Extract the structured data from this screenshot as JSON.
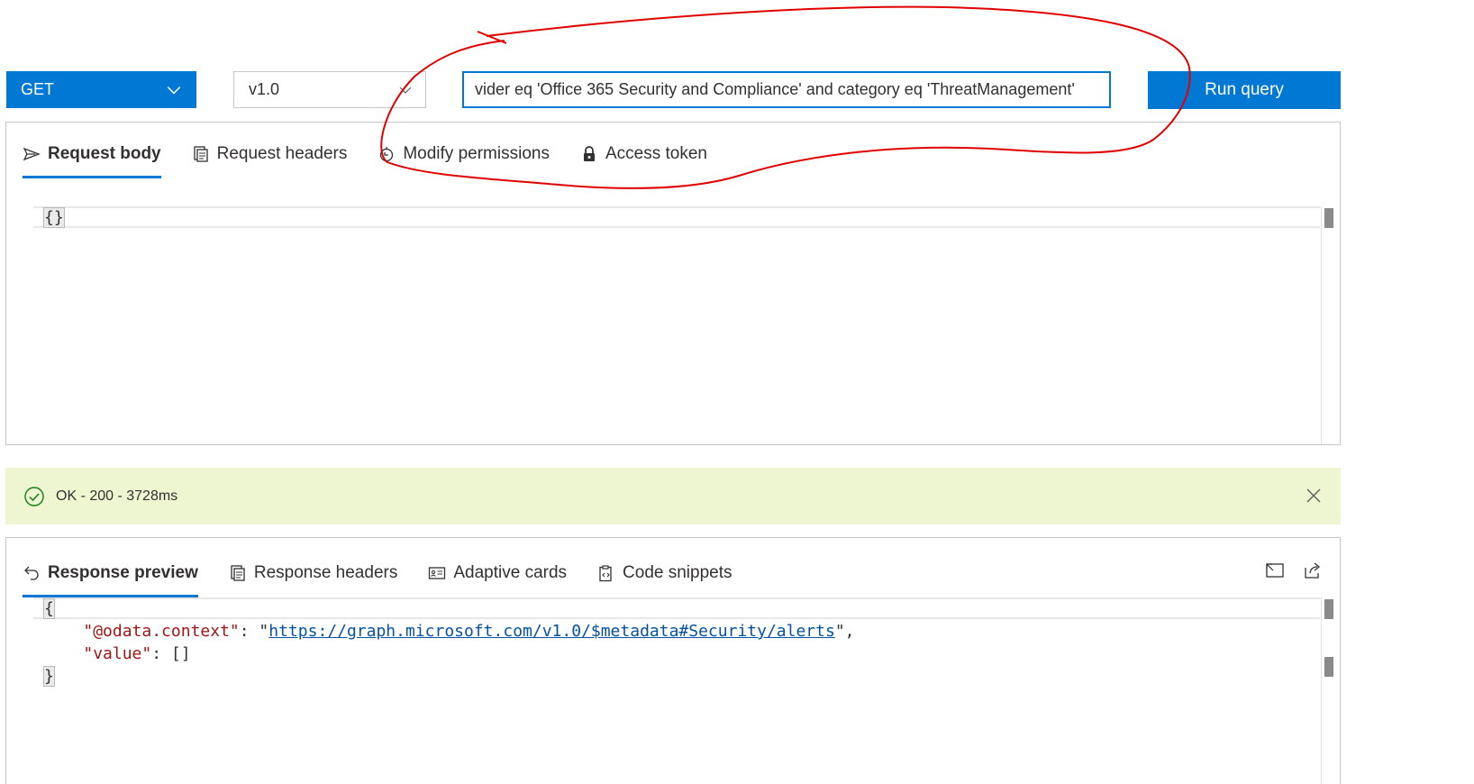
{
  "query_bar": {
    "method": "GET",
    "version": "v1.0",
    "url_value": "vider eq 'Office 365 Security and Compliance' and category eq 'ThreatManagement'",
    "run_label": "Run query"
  },
  "request": {
    "tabs": [
      {
        "label": "Request body",
        "icon": "send-icon",
        "active": true
      },
      {
        "label": "Request headers",
        "icon": "document-icon",
        "active": false
      },
      {
        "label": "Modify permissions",
        "icon": "permission-icon",
        "active": false
      },
      {
        "label": "Access token",
        "icon": "lock-icon",
        "active": false
      }
    ],
    "body": "{}"
  },
  "status": {
    "text": "OK - 200 - 3728ms",
    "color": "#eef5d1",
    "icon": "checkmark-circle-icon"
  },
  "response": {
    "tabs": [
      {
        "label": "Response preview",
        "icon": "undo-icon",
        "active": true
      },
      {
        "label": "Response headers",
        "icon": "document-icon",
        "active": false
      },
      {
        "label": "Adaptive cards",
        "icon": "card-icon",
        "active": false
      },
      {
        "label": "Code snippets",
        "icon": "clipboard-icon",
        "active": false
      }
    ],
    "json": {
      "open": "{",
      "context_key": "\"@odata.context\"",
      "context_value": "https://graph.microsoft.com/v1.0/$metadata#Security/alerts",
      "value_key": "\"value\"",
      "value_val": "[]",
      "close": "}"
    }
  },
  "colors": {
    "accent": "#0078d4",
    "annotation": "#e00000"
  }
}
